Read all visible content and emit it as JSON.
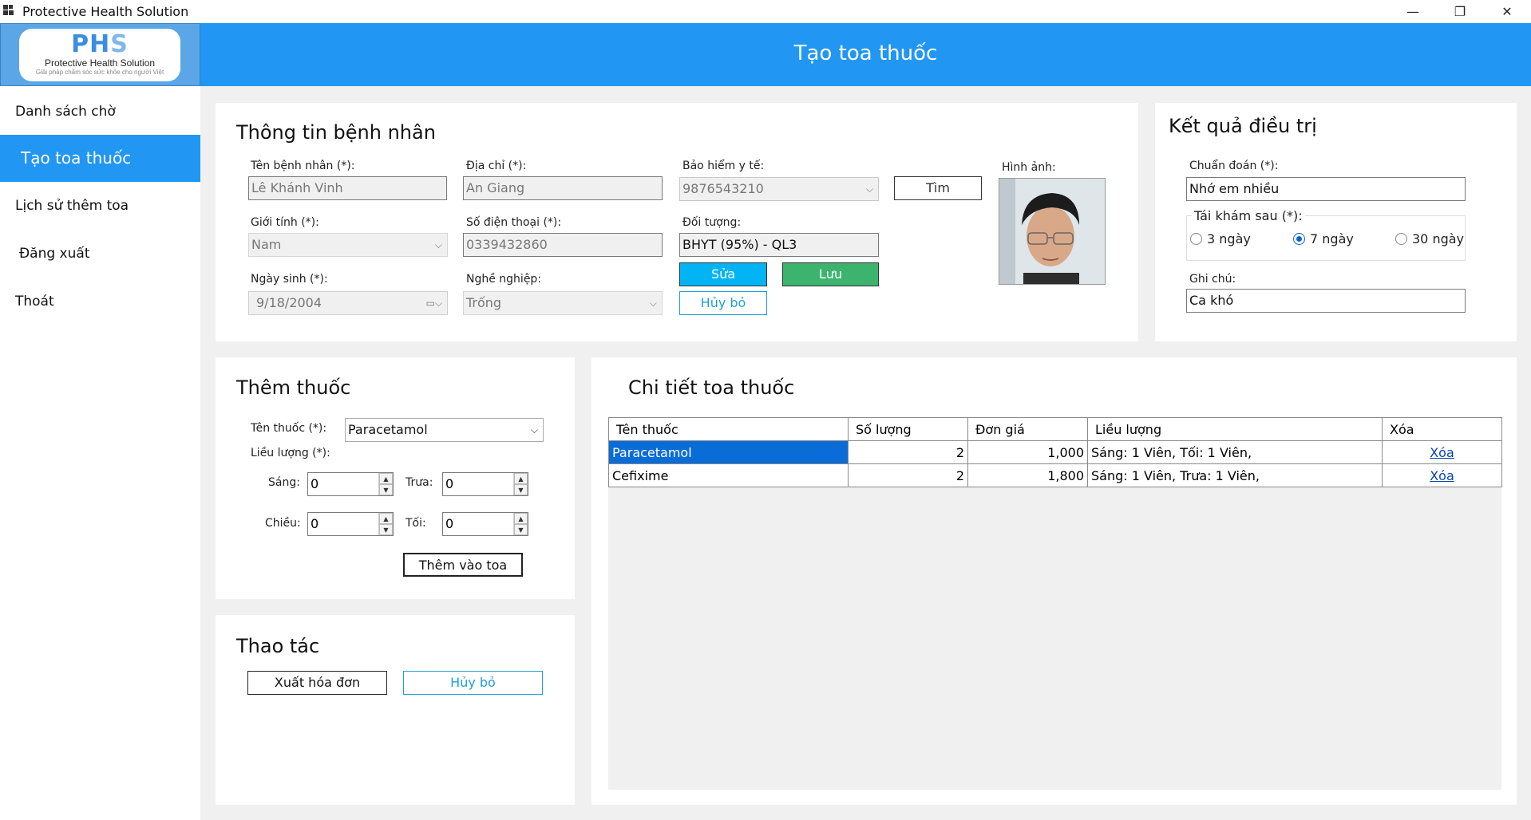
{
  "window": {
    "title": "Protective Health Solution",
    "minimize": "—",
    "maximize": "❐",
    "close": "✕"
  },
  "logo": {
    "letters_a": "PH",
    "letters_b": "S",
    "name": "Protective Health Solution",
    "tagline": "Giải pháp chăm sóc sức khỏe cho người Việt"
  },
  "header": {
    "title": "Tạo toa thuốc"
  },
  "sidebar": {
    "items": [
      {
        "label": "Danh sách chờ"
      },
      {
        "label": "Tạo toa thuốc",
        "active": true
      },
      {
        "label": "Lịch sử thêm toa"
      },
      {
        "label": "Đăng xuất"
      },
      {
        "label": "Thoát"
      }
    ]
  },
  "patient": {
    "title": "Thông tin bệnh nhân",
    "name_label": "Tên bệnh nhân (*):",
    "name_value": "Lê Khánh Vinh",
    "address_label": "Địa chỉ (*):",
    "address_value": "An Giang",
    "insurance_label": "Bảo hiểm y tế:",
    "insurance_value": "9876543210",
    "search_button": "Tìm",
    "photo_label": "Hình ảnh:",
    "gender_label": "Giới tính (*):",
    "gender_value": "Nam",
    "phone_label": "Số điện thoại (*):",
    "phone_value": "0339432860",
    "object_label": "Đối tượng:",
    "object_value": "BHYT (95%) - QL3",
    "edit_button": "Sửa",
    "save_button": "Lưu",
    "cancel_button": "Hủy bỏ",
    "dob_label": "Ngày sinh (*):",
    "dob_value": "9/18/2004",
    "job_label": "Nghề nghiệp:",
    "job_value": "Trống"
  },
  "result": {
    "title": "Kết quả điều trị",
    "diagnosis_label": "Chuẩn đoán (*):",
    "diagnosis_value": "Nhớ em nhiều",
    "revisit_label": "Tái khám sau (*):",
    "revisit_options": [
      {
        "label": "3 ngày",
        "checked": false
      },
      {
        "label": "7 ngày",
        "checked": true
      },
      {
        "label": "30 ngày",
        "checked": false
      }
    ],
    "note_label": "Ghi chú:",
    "note_value": "Ca khó"
  },
  "add_drug": {
    "title": "Thêm thuốc",
    "drug_label": "Tên thuốc (*):",
    "drug_value": "Paracetamol",
    "dose_label": "Liều lượng (*):",
    "morning_label": "Sáng:",
    "morning_value": "0",
    "noon_label": "Trưa:",
    "noon_value": "0",
    "afternoon_label": "Chiều:",
    "afternoon_value": "0",
    "night_label": "Tối:",
    "night_value": "0",
    "add_button": "Thêm vào toa"
  },
  "actions": {
    "title": "Thao tác",
    "export_button": "Xuất hóa đơn",
    "cancel_button": "Hủy bỏ"
  },
  "prescription": {
    "title": "Chi tiết toa thuốc",
    "columns": [
      "Tên thuốc",
      "Số lượng",
      "Đơn giá",
      "Liều lượng",
      "Xóa"
    ],
    "rows": [
      {
        "name": "Paracetamol",
        "qty": "2",
        "price": "1,000",
        "dose": "Sáng: 1 Viên, Tối: 1 Viên,",
        "delete": "Xóa"
      },
      {
        "name": "Cefixime",
        "qty": "2",
        "price": "1,800",
        "dose": "Sáng: 1 Viên, Trưa: 1 Viên,",
        "delete": "Xóa"
      }
    ]
  },
  "colors": {
    "header": "#2196f3",
    "edit_button": "#03b4f4",
    "save_button": "#3cb46e",
    "selected_row": "#0a6cd6"
  }
}
